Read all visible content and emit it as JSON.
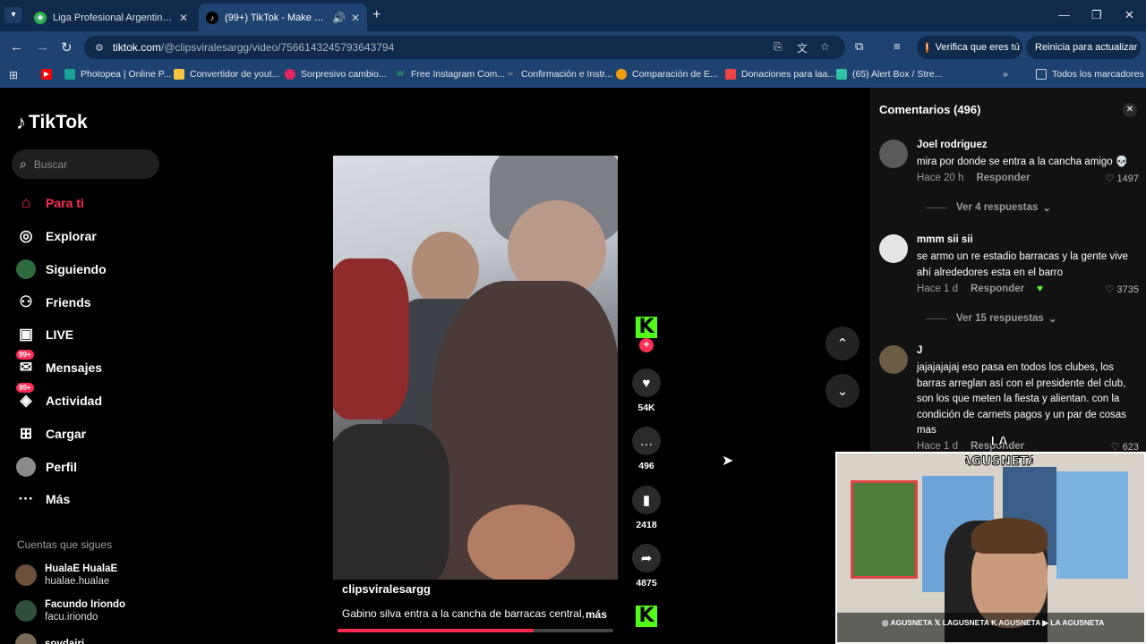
{
  "browser": {
    "tabs": [
      {
        "title": "Liga Profesional Argentina - PO",
        "active": false
      },
      {
        "title": "(99+) TikTok - Make Your Da",
        "active": true
      }
    ],
    "url_host": "tiktok.com",
    "url_path": "/@clipsviralesargg/video/7566143245793643794",
    "verify_button": "Verifica que eres tú",
    "restart_button": "Reinicia para actualizar",
    "bookmarks": [
      {
        "label": "Photopea | Online P...",
        "color": "#18a497"
      },
      {
        "label": "Convertidor de yout...",
        "color": "#f5c542"
      },
      {
        "label": "Sorpresivo cambio...",
        "color": "#e0245e"
      },
      {
        "label": "Free Instagram Com...",
        "color": "#22c55e"
      },
      {
        "label": "Confirmación e Instr...",
        "color": "#9ca3af"
      },
      {
        "label": "Comparación de E...",
        "color": "#f59e0b"
      },
      {
        "label": "Donaciones para laa...",
        "color": "#ef4444"
      },
      {
        "label": "(65) Alert Box / Stre...",
        "color": "#31c3a2"
      }
    ],
    "all_bookmarks": "Todos los marcadores"
  },
  "sidebar": {
    "brand": "TikTok",
    "search_placeholder": "Buscar",
    "nav": [
      {
        "label": "Para ti",
        "active": true
      },
      {
        "label": "Explorar"
      },
      {
        "label": "Siguiendo"
      },
      {
        "label": "Friends"
      },
      {
        "label": "LIVE"
      },
      {
        "label": "Mensajes",
        "badge": "99+"
      },
      {
        "label": "Actividad",
        "badge": "99+"
      },
      {
        "label": "Cargar"
      },
      {
        "label": "Perfil"
      },
      {
        "label": "Más"
      }
    ],
    "following_title": "Cuentas que sigues",
    "following": [
      {
        "name": "HualaE HualaE",
        "handle": "hualae.hualae"
      },
      {
        "name": "Facundo Iriondo",
        "handle": "facu.iriondo"
      },
      {
        "name": "soydairi",
        "handle": ""
      }
    ]
  },
  "video": {
    "author": "clipsviralesargg",
    "description": "Gabino silva entra a la cancha de barracas central,",
    "more": "más",
    "progress": 0.71,
    "likes": "54K",
    "comments": "496",
    "saves": "2418",
    "shares": "4875"
  },
  "comments_panel": {
    "title": "Comentarios (496)",
    "comments": [
      {
        "user": "Joel rodriguez",
        "text": "mira por donde se entra a la cancha amigo 💀",
        "time": "Hace 20 h",
        "reply": "Responder",
        "likes": "1497",
        "replies": "Ver 4 respuestas"
      },
      {
        "user": "mmm sii sii",
        "text": "se armo un re estadio barracas y la gente vive ahí alrededores esta en el barro",
        "time": "Hace 1 d",
        "reply": "Responder",
        "likes": "3735",
        "replies": "Ver 15 respuestas"
      },
      {
        "user": "J",
        "text": "jajajajajaj eso pasa en todos los clubes, los barras arreglan así con el presidente del club, son los que meten la fiesta y alientan. con la condición de carnets pagos y un par de cosas mas",
        "time": "Hace 1 d",
        "reply": "Responder",
        "likes": "623"
      }
    ]
  },
  "webcam": {
    "logo_line1": "LA",
    "logo_line2": "AGUSNETA",
    "social_bar": "◎ AGUSNETA   𝕏 LAGUSNETA   K AGUSNETA   ▶ LA AGUSNETA"
  },
  "colors": {
    "tiktok_red": "#fe2c55",
    "kick_green": "#53fc18",
    "chrome_dark": "#0f2a4a",
    "chrome_bar": "#1f4370"
  }
}
